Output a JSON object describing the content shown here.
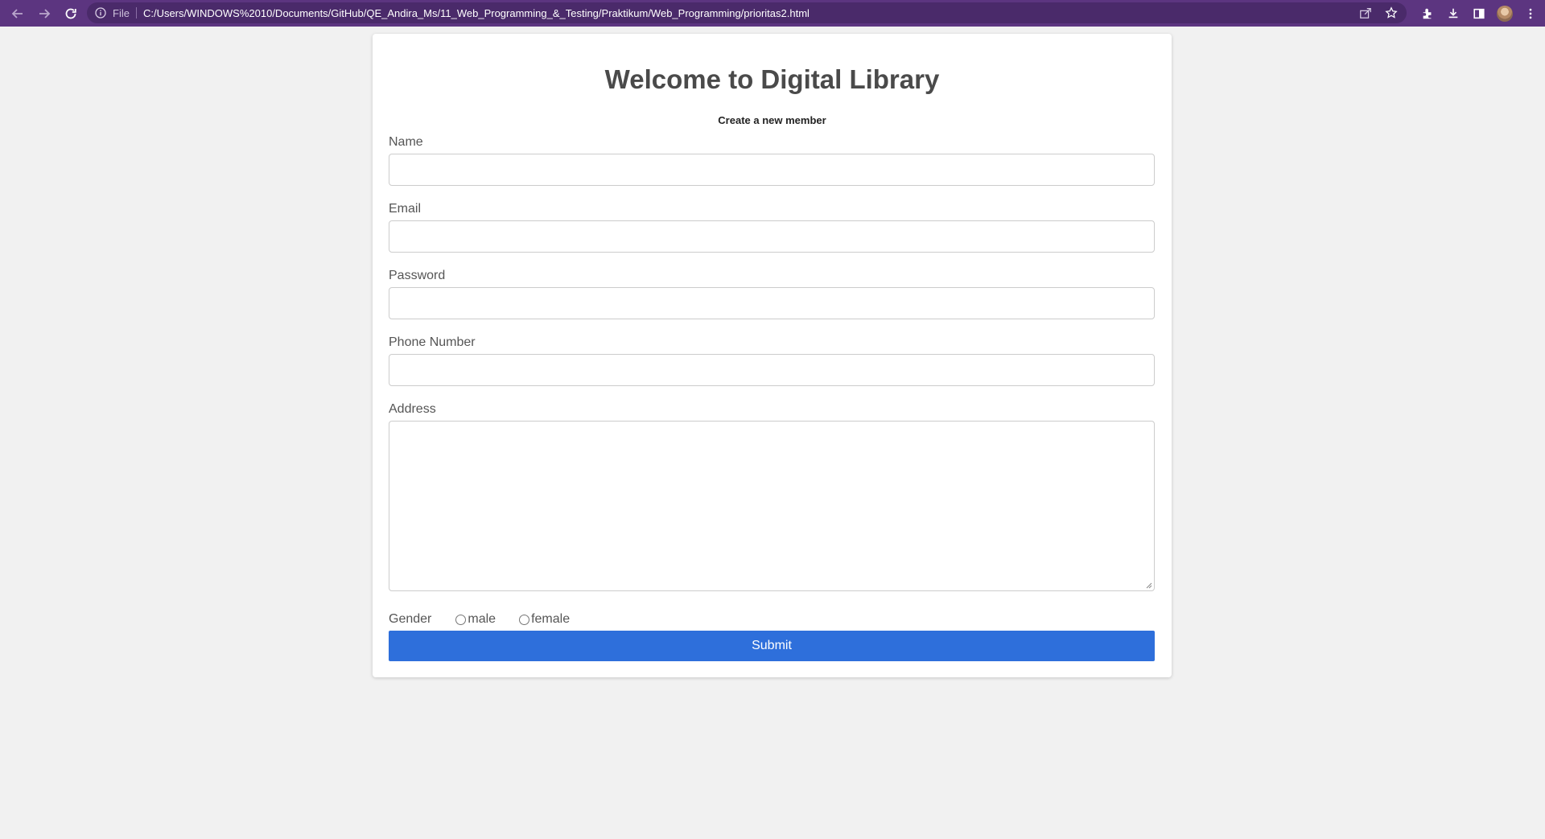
{
  "browser": {
    "url_scheme_label": "File",
    "url": "C:/Users/WINDOWS%2010/Documents/GitHub/QE_Andira_Ms/11_Web_Programming_&_Testing/Praktikum/Web_Programming/prioritas2.html",
    "icons": [
      "back-icon",
      "forward-icon",
      "reload-icon",
      "info-icon",
      "share-icon",
      "star-icon",
      "extensions-icon",
      "download-icon",
      "side-panel-icon",
      "avatar",
      "menu-icon"
    ],
    "toolbar_color": "#5c3580"
  },
  "form": {
    "title": "Welcome to Digital Library",
    "subtitle": "Create a new member",
    "fields": {
      "name_label": "Name",
      "email_label": "Email",
      "password_label": "Password",
      "phone_label": "Phone Number",
      "address_label": "Address"
    },
    "values": {
      "name": "",
      "email": "",
      "password": "",
      "phone": "",
      "address": ""
    },
    "gender": {
      "label": "Gender",
      "options": [
        "male",
        "female"
      ],
      "selected": null
    },
    "submit_label": "Submit",
    "accent_color": "#2e6fdb"
  }
}
